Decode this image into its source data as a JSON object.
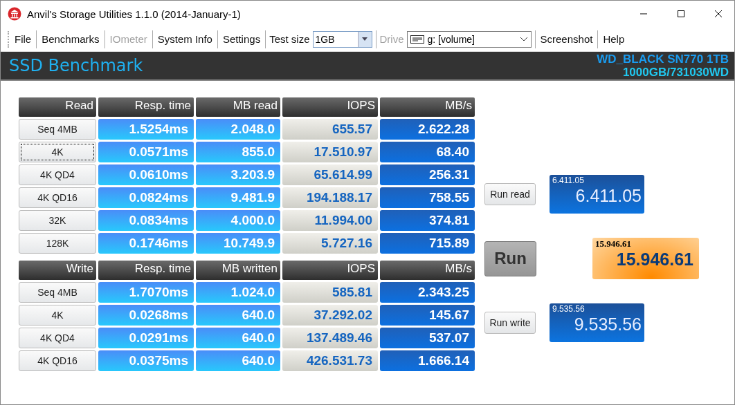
{
  "window": {
    "title": "Anvil's Storage Utilities 1.1.0 (2014-January-1)"
  },
  "toolbar": {
    "items": [
      {
        "kind": "menu",
        "label": "File",
        "disabled": false
      },
      {
        "kind": "menu",
        "label": "Benchmarks",
        "disabled": false
      },
      {
        "kind": "menu",
        "label": "IOmeter",
        "disabled": true
      },
      {
        "kind": "menu",
        "label": "System Info",
        "disabled": false
      },
      {
        "kind": "menu",
        "label": "Settings",
        "disabled": false
      },
      {
        "kind": "combo",
        "label": "Test size",
        "value": "1GB",
        "disabled": false
      },
      {
        "kind": "drive",
        "label": "Drive",
        "value": "g: [volume]",
        "disabled": true
      },
      {
        "kind": "menu",
        "label": "Screenshot",
        "disabled": false
      },
      {
        "kind": "menu",
        "label": "Help",
        "disabled": false
      }
    ]
  },
  "header": {
    "title": "SSD Benchmark",
    "drive_model": "WD_BLACK SN770 1TB",
    "drive_info": "1000GB/731030WD"
  },
  "tables": [
    {
      "columns": [
        "Read",
        "Resp. time",
        "MB read",
        "IOPS",
        "MB/s"
      ],
      "rows": [
        {
          "focused": false,
          "cells": [
            "Seq 4MB",
            "1.5254ms",
            "2.048.0",
            "655.57",
            "2.622.28"
          ]
        },
        {
          "focused": true,
          "cells": [
            "4K",
            "0.0571ms",
            "855.0",
            "17.510.97",
            "68.40"
          ]
        },
        {
          "focused": false,
          "cells": [
            "4K QD4",
            "0.0610ms",
            "3.203.9",
            "65.614.99",
            "256.31"
          ]
        },
        {
          "focused": false,
          "cells": [
            "4K QD16",
            "0.0824ms",
            "9.481.9",
            "194.188.17",
            "758.55"
          ]
        },
        {
          "focused": false,
          "cells": [
            "32K",
            "0.0834ms",
            "4.000.0",
            "11.994.00",
            "374.81"
          ]
        },
        {
          "focused": false,
          "cells": [
            "128K",
            "0.1746ms",
            "10.749.9",
            "5.727.16",
            "715.89"
          ]
        }
      ]
    },
    {
      "columns": [
        "Write",
        "Resp. time",
        "MB written",
        "IOPS",
        "MB/s"
      ],
      "rows": [
        {
          "focused": false,
          "cells": [
            "Seq 4MB",
            "1.7070ms",
            "1.024.0",
            "585.81",
            "2.343.25"
          ]
        },
        {
          "focused": false,
          "cells": [
            "4K",
            "0.0268ms",
            "640.0",
            "37.292.02",
            "145.67"
          ]
        },
        {
          "focused": false,
          "cells": [
            "4K QD4",
            "0.0291ms",
            "640.0",
            "137.489.46",
            "537.07"
          ]
        },
        {
          "focused": false,
          "cells": [
            "4K QD16",
            "0.0375ms",
            "640.0",
            "426.531.73",
            "1.666.14"
          ]
        }
      ]
    }
  ],
  "scores": {
    "read": {
      "button": "Run read",
      "small": "6.411.05",
      "value": "6.411.05"
    },
    "run_button": "Run",
    "total": {
      "small": "15.946.61",
      "value": "15.946.61"
    },
    "write": {
      "button": "Run write",
      "small": "9.535.56",
      "value": "9.535.56"
    }
  }
}
